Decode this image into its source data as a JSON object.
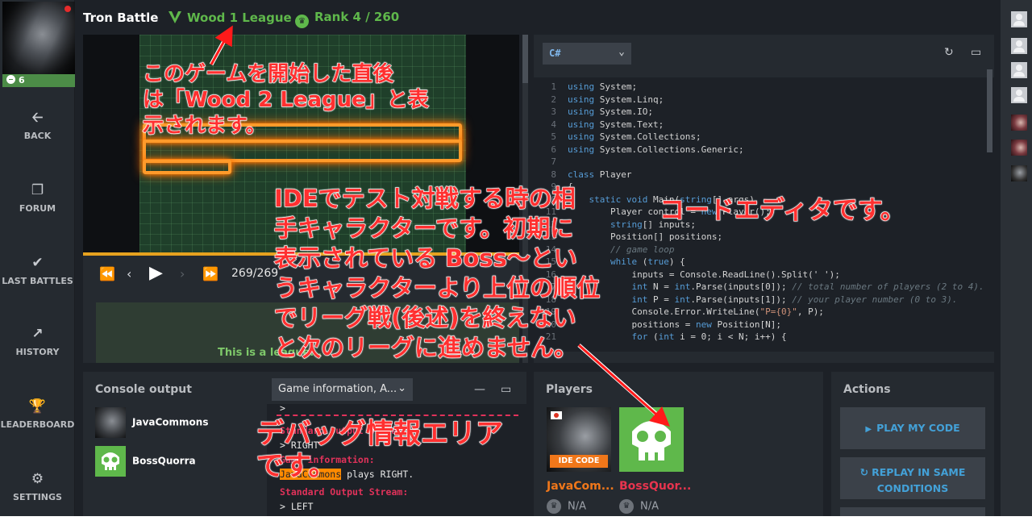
{
  "header": {
    "title": "Tron Battle",
    "league": "Wood 1 League",
    "rank": "Rank 4 / 260"
  },
  "user": {
    "xp": "6"
  },
  "nav": [
    {
      "label": "BACK",
      "icon": "arrow-left-icon"
    },
    {
      "label": "FORUM",
      "icon": "forum-icon"
    },
    {
      "label": "LAST BATTLES",
      "icon": "versus-icon"
    },
    {
      "label": "HISTORY",
      "icon": "chart-line-icon"
    },
    {
      "label": "LEADERBOARD",
      "icon": "trophy-icon"
    },
    {
      "label": "SETTINGS",
      "icon": "gear-icon"
    }
  ],
  "viewer": {
    "frame": "269/269",
    "progress": 1.0,
    "league_message": "This is a league..."
  },
  "editor": {
    "language": "C#",
    "lines": [
      {
        "n": "1",
        "code": "using System;"
      },
      {
        "n": "2",
        "code": "using System.Linq;"
      },
      {
        "n": "3",
        "code": "using System.IO;"
      },
      {
        "n": "4",
        "code": "using System.Text;"
      },
      {
        "n": "5",
        "code": "using System.Collections;"
      },
      {
        "n": "6",
        "code": "using System.Collections.Generic;"
      },
      {
        "n": "7",
        "code": ""
      },
      {
        "n": "8",
        "code": "class Player"
      },
      {
        "n": "9",
        "code": "{"
      },
      {
        "n": "10",
        "code": "    static void Main(string[] args)"
      },
      {
        "n": "11",
        "code": "        Player control = new Player();"
      },
      {
        "n": "12",
        "code": "        string[] inputs;"
      },
      {
        "n": "13",
        "code": "        Position[] positions;"
      },
      {
        "n": "14",
        "code": "        // game loop"
      },
      {
        "n": "15",
        "code": "        while (true) {"
      },
      {
        "n": "16",
        "code": "            inputs = Console.ReadLine().Split(' ');"
      },
      {
        "n": "17",
        "code": "            int N = int.Parse(inputs[0]); // total number of players (2 to 4)."
      },
      {
        "n": "18",
        "code": "            int P = int.Parse(inputs[1]); // your player number (0 to 3)."
      },
      {
        "n": "19",
        "code": "            Console.Error.WriteLine(\"P={0}\", P);"
      },
      {
        "n": "20",
        "code": "            positions = new Position[N];"
      },
      {
        "n": "21",
        "code": "            for (int i = 0; i < N; i++) {"
      }
    ]
  },
  "console": {
    "title": "Console output",
    "players": [
      "JavaCommons",
      "BossQuorra"
    ],
    "select_value": "Game information, A...",
    "log": [
      {
        "text": ">",
        "style": "normal"
      },
      {
        "text": "Standard Output Stream:",
        "style": "red"
      },
      {
        "text": "> RIGHT",
        "style": "normal"
      },
      {
        "text": "Game information:",
        "style": "red"
      },
      {
        "text_pre": "",
        "highlight": "JavaCommons",
        "text_post": " plays RIGHT.",
        "style": "mixed"
      },
      {
        "text": "Standard Output Stream:",
        "style": "red"
      },
      {
        "text": "> LEFT",
        "style": "normal"
      }
    ]
  },
  "players_panel": {
    "title": "Players",
    "players": [
      {
        "name": "JavaCom...",
        "color": "#f0771a",
        "rank": "N/A",
        "badge": "IDE CODE"
      },
      {
        "name": "BossQuor...",
        "color": "#e8344e",
        "rank": "N/A"
      }
    ]
  },
  "actions": {
    "title": "Actions",
    "play": "PLAY MY CODE",
    "replay": "REPLAY IN SAME\nCONDITIONS"
  },
  "annotations": {
    "a1": "このゲームを開始した直後\nは「Wood 2 League」と表\n示されます。",
    "a2": "IDEでテスト対戦する時の相\n手キャラクターです。初期に\n表示されている Boss～とい\nうキャラクターより上位の順位\nでリーグ戦(後述)を終えない\nと次のリーグに進めません。",
    "a3": "コードエディタです。",
    "a4": "デバッグ情報エリア\nです。"
  },
  "colors": {
    "accent_green": "#5fb84b",
    "link_blue": "#43a1d8",
    "annotation_red": "#ff3030",
    "neon_orange": "#ff9a2a"
  }
}
